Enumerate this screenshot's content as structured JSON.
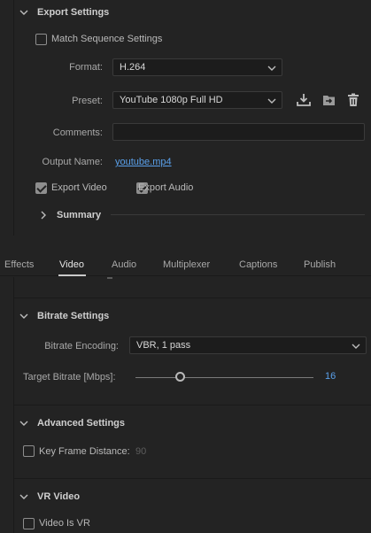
{
  "export_settings": {
    "header": "Export Settings",
    "match_sequence": {
      "label": "Match Sequence Settings",
      "checked": false
    },
    "format": {
      "label": "Format:",
      "value": "H.264"
    },
    "preset": {
      "label": "Preset:",
      "value": "YouTube 1080p Full HD"
    },
    "comments": {
      "label": "Comments:",
      "value": ""
    },
    "output_name": {
      "label": "Output Name:",
      "value": "youtube.mp4"
    },
    "export_video": {
      "label": "Export Video",
      "checked": true
    },
    "export_audio": {
      "label": "Export Audio",
      "checked": true
    },
    "summary": "Summary",
    "preset_icons": [
      "save-preset-icon",
      "import-preset-icon",
      "delete-preset-icon"
    ]
  },
  "tabs": [
    {
      "label": "Effects",
      "active": false
    },
    {
      "label": "Video",
      "active": true
    },
    {
      "label": "Audio",
      "active": false
    },
    {
      "label": "Multiplexer",
      "active": false
    },
    {
      "label": "Captions",
      "active": false
    },
    {
      "label": "Publish",
      "active": false
    }
  ],
  "bitrate_settings": {
    "header": "Bitrate Settings",
    "encoding": {
      "label": "Bitrate Encoding:",
      "value": "VBR, 1 pass"
    },
    "target": {
      "label": "Target Bitrate [Mbps]:",
      "value": "16"
    }
  },
  "advanced_settings": {
    "header": "Advanced Settings",
    "key_frame": {
      "label": "Key Frame Distance:",
      "value": "90",
      "checked": false
    }
  },
  "vr_video": {
    "header": "VR Video",
    "video_is_vr": {
      "label": "Video Is VR",
      "checked": false
    }
  },
  "colors": {
    "accent_blue": "#5aa0ea",
    "panel_bg": "#232323",
    "field_bg": "#1c1c1c"
  }
}
